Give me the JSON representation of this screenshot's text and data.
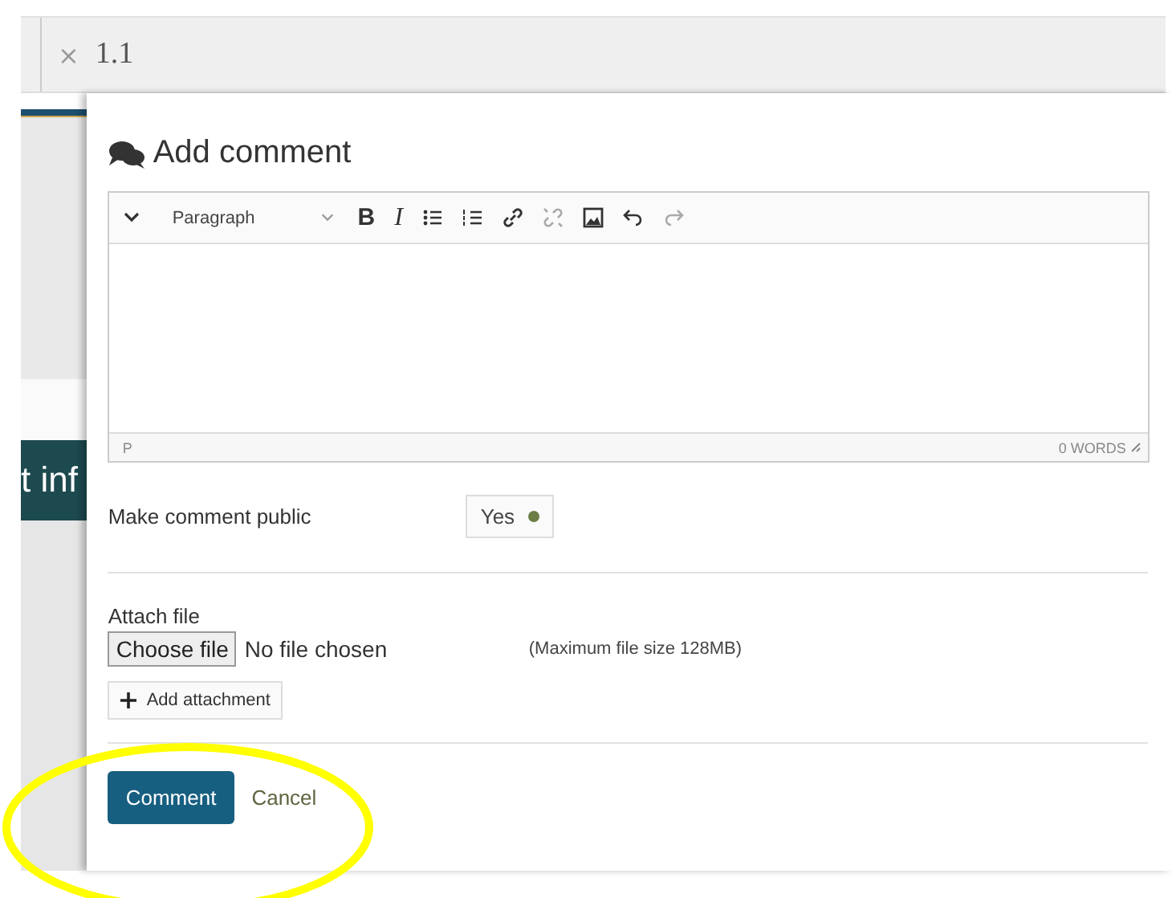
{
  "background": {
    "banner_text": "t inf"
  },
  "tab_bar": {
    "close": "×",
    "title": "1.1"
  },
  "dialog": {
    "heading": "Add comment",
    "editor": {
      "toolbar": [
        {
          "kind": "chevron",
          "disabled": false
        },
        {
          "kind": "dropdown",
          "label": "Paragraph",
          "disabled": false
        },
        {
          "kind": "bold",
          "label": "B",
          "disabled": false
        },
        {
          "kind": "italic",
          "label": "I",
          "disabled": false
        },
        {
          "kind": "bullets",
          "disabled": false
        },
        {
          "kind": "numbers",
          "disabled": false
        },
        {
          "kind": "link",
          "disabled": false
        },
        {
          "kind": "unlink",
          "disabled": true
        },
        {
          "kind": "image",
          "disabled": false
        },
        {
          "kind": "undo",
          "disabled": false
        },
        {
          "kind": "redo",
          "disabled": true
        }
      ],
      "path": "P",
      "word_count": "0 WORDS"
    },
    "public_toggle": {
      "label": "Make comment public",
      "value": "Yes",
      "on": true
    },
    "attach": {
      "label": "Attach file",
      "choose_button": "Choose file",
      "file_status": "No file chosen",
      "limit": "(Maximum file size 128MB)",
      "add_button": "Add attachment"
    },
    "buttons": {
      "submit": "Comment",
      "cancel": "Cancel"
    }
  },
  "annotation": {
    "kind": "ellipse",
    "color": "#ffff00"
  }
}
